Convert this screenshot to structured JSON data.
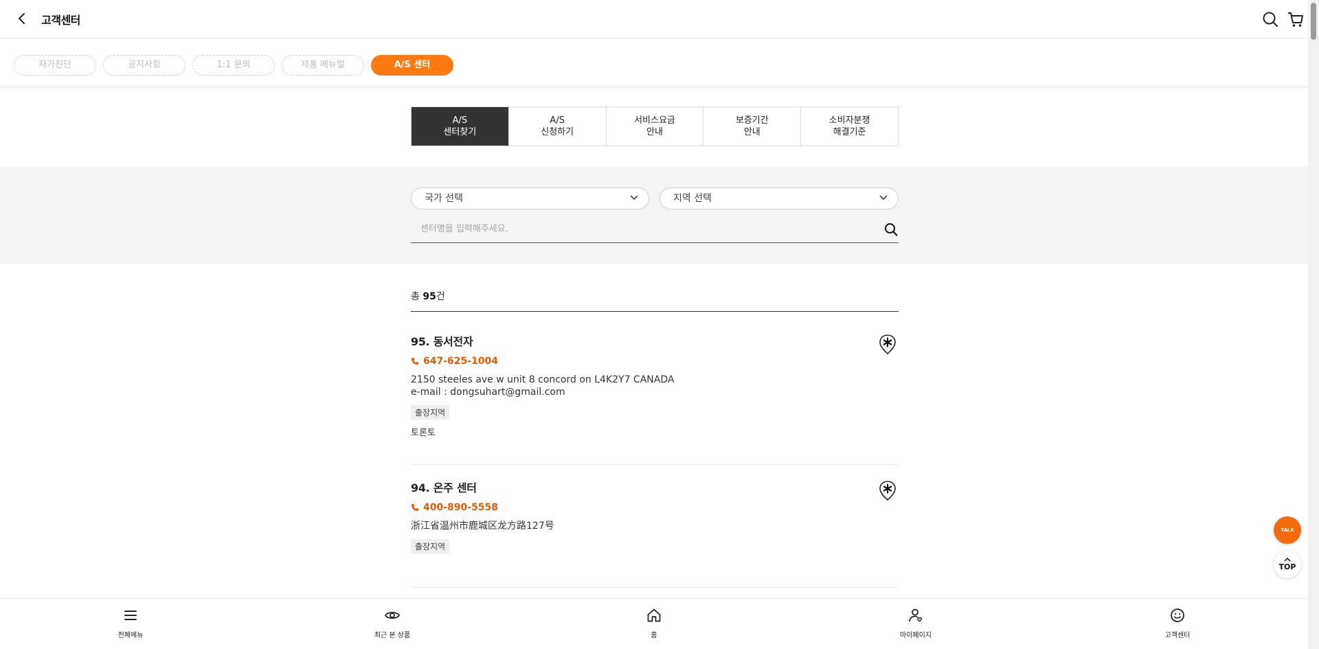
{
  "header": {
    "title": "고객센터"
  },
  "pill_nav": [
    {
      "label": "자가진단",
      "active": false
    },
    {
      "label": "공지사항",
      "active": false
    },
    {
      "label": "1:1 문의",
      "active": false
    },
    {
      "label": "제품 메뉴얼",
      "active": false
    },
    {
      "label": "A/S 센터",
      "active": true
    }
  ],
  "tabs": [
    {
      "line1": "A/S",
      "line2": "센터찾기",
      "active": true
    },
    {
      "line1": "A/S",
      "line2": "신청하기",
      "active": false
    },
    {
      "line1": "서비스요금",
      "line2": "안내",
      "active": false
    },
    {
      "line1": "보증기간",
      "line2": "안내",
      "active": false
    },
    {
      "line1": "소비자분쟁",
      "line2": "해결기준",
      "active": false
    }
  ],
  "filters": {
    "country_placeholder": "국가 선택",
    "region_placeholder": "지역 선택",
    "search_placeholder": "센터명을 입력해주세요."
  },
  "results": {
    "total_prefix": "총 ",
    "total_count": "95",
    "total_suffix": "건",
    "items": [
      {
        "name": "95. 동서전자",
        "phone": "647-625-1004",
        "address": "2150 steeles ave w unit 8 concord on L4K2Y7 CANADA",
        "email": "e-mail : dongsuhart@gmail.com",
        "badge": "출장지역",
        "region": "토론토"
      },
      {
        "name": "94. 온주 센터",
        "phone": "400-890-5558",
        "address": "浙江省温州市鹿城区龙方路127号",
        "badge": "출장지역"
      }
    ]
  },
  "floating": {
    "talk_label": "TALK",
    "top_label": "TOP"
  },
  "bottom_nav": [
    {
      "label": "전체메뉴",
      "icon": "menu-icon"
    },
    {
      "label": "최근 본 상품",
      "icon": "eye-icon"
    },
    {
      "label": "홈",
      "icon": "home-icon"
    },
    {
      "label": "마이페이지",
      "icon": "user-icon"
    },
    {
      "label": "고객센터",
      "icon": "smile-icon"
    }
  ],
  "colors": {
    "accent": "#ff7a10",
    "phone": "#e85d04",
    "active_tab": "#333333"
  }
}
